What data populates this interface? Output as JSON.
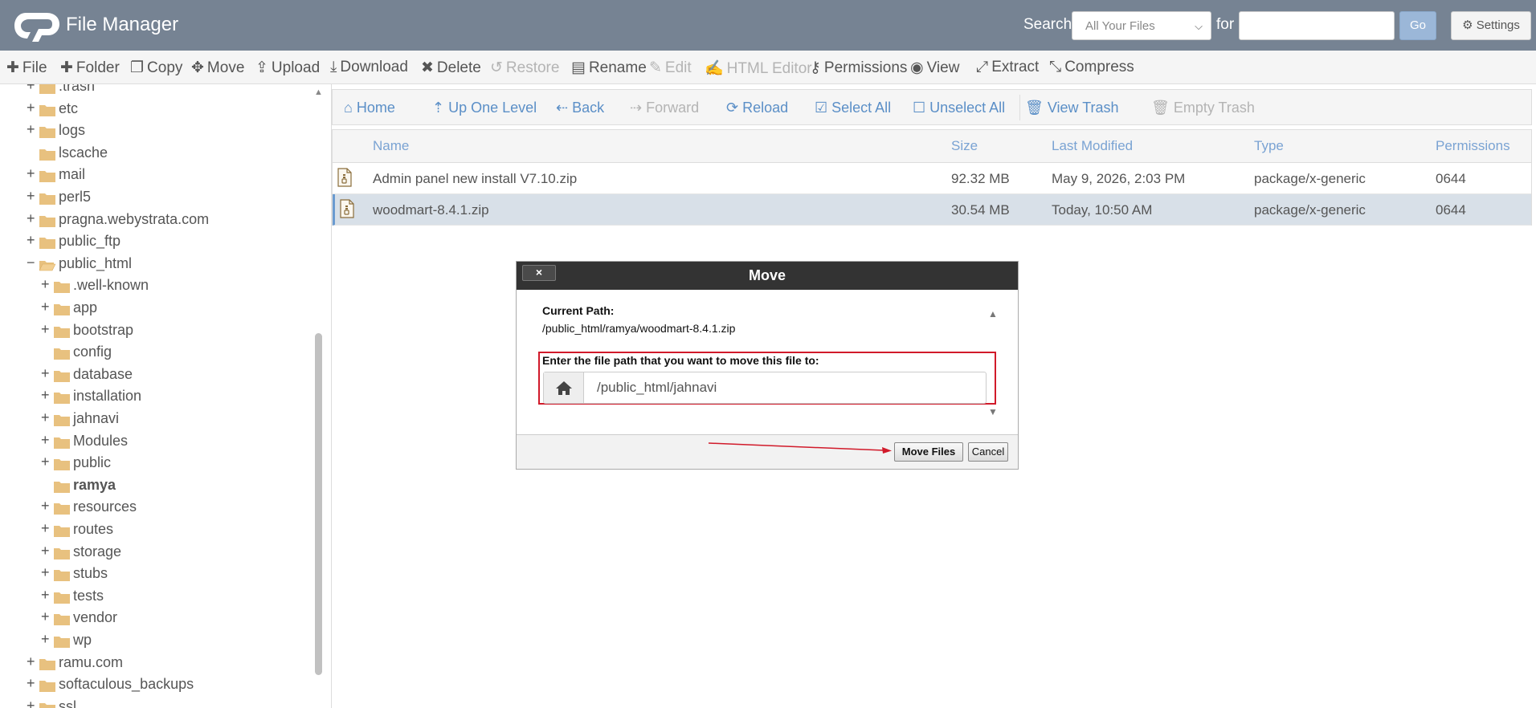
{
  "header": {
    "app_title": "File Manager",
    "search_label": "Search",
    "search_scope": "All Your Files",
    "for_label": "for",
    "search_query": "",
    "go_label": "Go",
    "settings_label": "Settings",
    "colors": {
      "header_bg": "#768393",
      "go_button": "#9bb7d8"
    }
  },
  "toolbar": {
    "items": [
      {
        "label": "File",
        "icon": "plus-icon",
        "disabled": false
      },
      {
        "label": "Folder",
        "icon": "plus-icon",
        "disabled": false
      },
      {
        "label": "Copy",
        "icon": "copy-icon",
        "disabled": false
      },
      {
        "label": "Move",
        "icon": "move-icon",
        "disabled": false
      },
      {
        "label": "Upload",
        "icon": "upload-icon",
        "disabled": false
      },
      {
        "label": "Download",
        "icon": "download-icon",
        "disabled": false
      },
      {
        "label": "Delete",
        "icon": "delete-icon",
        "disabled": false
      },
      {
        "label": "Restore",
        "icon": "restore-icon",
        "disabled": true
      },
      {
        "label": "Rename",
        "icon": "rename-icon",
        "disabled": false
      },
      {
        "label": "Edit",
        "icon": "pencil-icon",
        "disabled": true
      },
      {
        "label": "HTML Editor",
        "icon": "html-editor-icon",
        "disabled": true
      },
      {
        "label": "Permissions",
        "icon": "key-icon",
        "disabled": false
      },
      {
        "label": "View",
        "icon": "eye-icon",
        "disabled": false
      },
      {
        "label": "Extract",
        "icon": "extract-icon",
        "disabled": false
      },
      {
        "label": "Compress",
        "icon": "compress-icon",
        "disabled": false
      }
    ]
  },
  "sidebar": {
    "items": [
      {
        "label": ".trash",
        "depth": 0,
        "expander": "+",
        "bold": false
      },
      {
        "label": "etc",
        "depth": 0,
        "expander": "+",
        "bold": false
      },
      {
        "label": "logs",
        "depth": 0,
        "expander": "+",
        "bold": false
      },
      {
        "label": "lscache",
        "depth": 0,
        "expander": "",
        "bold": false
      },
      {
        "label": "mail",
        "depth": 0,
        "expander": "+",
        "bold": false
      },
      {
        "label": "perl5",
        "depth": 0,
        "expander": "+",
        "bold": false
      },
      {
        "label": "pragna.webystrata.com",
        "depth": 0,
        "expander": "+",
        "bold": false
      },
      {
        "label": "public_ftp",
        "depth": 0,
        "expander": "+",
        "bold": false
      },
      {
        "label": "public_html",
        "depth": 0,
        "expander": "−",
        "bold": false,
        "open": true
      },
      {
        "label": ".well-known",
        "depth": 1,
        "expander": "+",
        "bold": false
      },
      {
        "label": "app",
        "depth": 1,
        "expander": "+",
        "bold": false
      },
      {
        "label": "bootstrap",
        "depth": 1,
        "expander": "+",
        "bold": false
      },
      {
        "label": "config",
        "depth": 1,
        "expander": "",
        "bold": false
      },
      {
        "label": "database",
        "depth": 1,
        "expander": "+",
        "bold": false
      },
      {
        "label": "installation",
        "depth": 1,
        "expander": "+",
        "bold": false
      },
      {
        "label": "jahnavi",
        "depth": 1,
        "expander": "+",
        "bold": false
      },
      {
        "label": "Modules",
        "depth": 1,
        "expander": "+",
        "bold": false
      },
      {
        "label": "public",
        "depth": 1,
        "expander": "+",
        "bold": false
      },
      {
        "label": "ramya",
        "depth": 1,
        "expander": "",
        "bold": true
      },
      {
        "label": "resources",
        "depth": 1,
        "expander": "+",
        "bold": false
      },
      {
        "label": "routes",
        "depth": 1,
        "expander": "+",
        "bold": false
      },
      {
        "label": "storage",
        "depth": 1,
        "expander": "+",
        "bold": false
      },
      {
        "label": "stubs",
        "depth": 1,
        "expander": "+",
        "bold": false
      },
      {
        "label": "tests",
        "depth": 1,
        "expander": "+",
        "bold": false
      },
      {
        "label": "vendor",
        "depth": 1,
        "expander": "+",
        "bold": false
      },
      {
        "label": "wp",
        "depth": 1,
        "expander": "+",
        "bold": false
      },
      {
        "label": "ramu.com",
        "depth": 0,
        "expander": "+",
        "bold": false
      },
      {
        "label": "softaculous_backups",
        "depth": 0,
        "expander": "+",
        "bold": false
      },
      {
        "label": "ssl",
        "depth": 0,
        "expander": "+",
        "bold": false
      }
    ]
  },
  "navbar": {
    "items": [
      {
        "label": "Home",
        "icon": "home-icon",
        "disabled": false
      },
      {
        "label": "Up One Level",
        "icon": "level-up-icon",
        "disabled": false
      },
      {
        "label": "Back",
        "icon": "arrow-left-icon",
        "disabled": false
      },
      {
        "label": "Forward",
        "icon": "arrow-right-icon",
        "disabled": true
      },
      {
        "label": "Reload",
        "icon": "reload-icon",
        "disabled": false
      },
      {
        "label": "Select All",
        "icon": "checkbox-checked-icon",
        "disabled": false
      },
      {
        "label": "Unselect All",
        "icon": "checkbox-empty-icon",
        "disabled": false
      },
      {
        "label": "View Trash",
        "icon": "trash-icon",
        "disabled": false
      },
      {
        "label": "Empty Trash",
        "icon": "trash-icon",
        "disabled": true
      }
    ]
  },
  "table": {
    "columns": [
      "Name",
      "Size",
      "Last Modified",
      "Type",
      "Permissions"
    ],
    "rows": [
      {
        "name": "Admin panel new install V7.10.zip",
        "size": "92.32 MB",
        "modified": "May 9, 2026, 2:03 PM",
        "type": "package/x-generic",
        "perms": "0644",
        "selected": false
      },
      {
        "name": "woodmart-8.4.1.zip",
        "size": "30.54 MB",
        "modified": "Today, 10:50 AM",
        "type": "package/x-generic",
        "perms": "0644",
        "selected": true
      }
    ]
  },
  "dialog": {
    "title": "Move",
    "close_label": "×",
    "current_path_label": "Current Path:",
    "current_path": "/public_html/ramya/woodmart-8.4.1.zip",
    "input_label": "Enter the file path that you want to move this file to:",
    "input_value": "/public_html/jahnavi",
    "move_button": "Move Files",
    "cancel_button": "Cancel"
  }
}
